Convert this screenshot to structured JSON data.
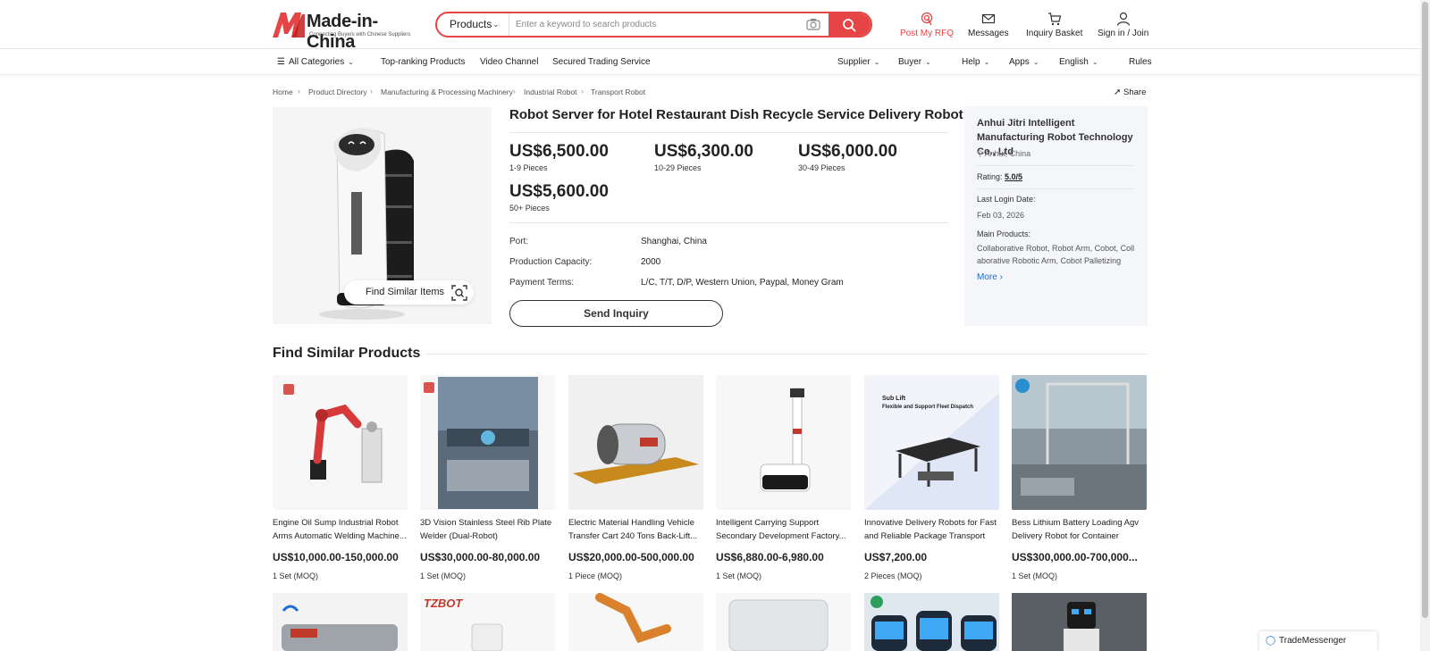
{
  "brand": {
    "name": "Made-in-China",
    "tagline": "Connecting Buyers with Chinese Suppliers",
    "accent": "#e64545"
  },
  "search": {
    "category": "Products",
    "placeholder": "Enter a keyword to search products"
  },
  "header_actions": [
    {
      "label": "Post My RFQ",
      "icon": "rfq-icon",
      "color": "#e64545"
    },
    {
      "label": "Messages",
      "icon": "mail-icon"
    },
    {
      "label": "Inquiry Basket",
      "icon": "cart-icon"
    },
    {
      "label": "Sign in / Join",
      "icon": "user-icon"
    }
  ],
  "nav": {
    "all_categories": "All Categories",
    "left": [
      "Top-ranking Products",
      "Video Channel",
      "Secured Trading Service"
    ],
    "right": [
      "Supplier",
      "Buyer",
      "Help",
      "Apps",
      "English",
      "Rules"
    ]
  },
  "breadcrumb": [
    "Home",
    "Product Directory",
    "Manufacturing & Processing Machinery",
    "Industrial Robot",
    "Transport Robot"
  ],
  "share_label": "Share",
  "find_similar_items": "Find Similar Items",
  "product": {
    "title": "Robot Server for Hotel Restaurant Dish Recycle Service Delivery Robot",
    "prices": [
      {
        "price": "US$6,500.00",
        "qty": "1-9 Pieces"
      },
      {
        "price": "US$6,300.00",
        "qty": "10-29 Pieces"
      },
      {
        "price": "US$6,000.00",
        "qty": "30-49 Pieces"
      },
      {
        "price": "US$5,600.00",
        "qty": "50+ Pieces"
      }
    ],
    "attributes": [
      {
        "label": "Port:",
        "value": "Shanghai, China"
      },
      {
        "label": "Production Capacity:",
        "value": "2000"
      },
      {
        "label": "Payment Terms:",
        "value": "L/C, T/T, D/P, Western Union, Paypal, Money Gram"
      }
    ],
    "send_inquiry": "Send Inquiry"
  },
  "supplier": {
    "name": "Anhui Jitri Intelligent Manufacturing Robot Technology Co., Ltd",
    "location": "Anhui, China",
    "rating_label": "Rating:",
    "rating": "5.0/5",
    "last_login_label": "Last Login Date:",
    "last_login": "Feb 03, 2026",
    "main_products_label": "Main Products:",
    "main_products": "Collaborative Robot, Robot Arm, Cobot, Collaborative Robotic Arm, Cobot Palletizing",
    "more": "More"
  },
  "similar": {
    "title": "Find Similar Products",
    "items": [
      {
        "name": "Engine Oil Sump Industrial Robot Arms Automatic Welding Machine...",
        "price": "US$10,000.00-150,000.00",
        "moq": "1 Set (MOQ)"
      },
      {
        "name": "3D Vision Stainless Steel Rib Plate Welder (Dual-Robot)",
        "price": "US$30,000.00-80,000.00",
        "moq": "1 Set (MOQ)"
      },
      {
        "name": "Electric Material Handling Vehicle Transfer Cart 240 Tons Back-Lift...",
        "price": "US$20,000.00-500,000.00",
        "moq": "1 Piece (MOQ)"
      },
      {
        "name": "Intelligent Carrying Support Secondary Development Factory...",
        "price": "US$6,880.00-6,980.00",
        "moq": "1 Set (MOQ)"
      },
      {
        "name": "Innovative Delivery Robots for Fast and Reliable Package Transport",
        "price": "US$7,200.00",
        "moq": "2 Pieces (MOQ)"
      },
      {
        "name": "Bess Lithium Battery Loading Agv Delivery Robot for Container Energ...",
        "price": "US$300,000.00-700,000...",
        "moq": "1 Set (MOQ)"
      }
    ],
    "image_texts": {
      "sublift_title": "Sub Lift",
      "sublift_sub": "Flexible and Support Fleet Dispatch",
      "tzbot": "TZBOT"
    }
  },
  "trademessenger": "TradeMessenger"
}
